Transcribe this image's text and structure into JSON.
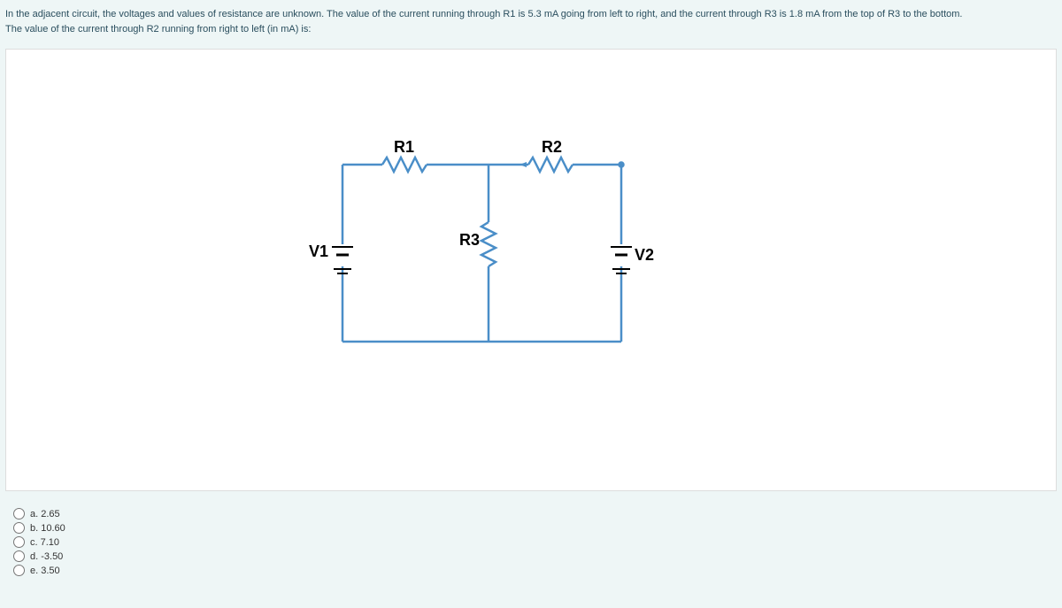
{
  "question": {
    "line1": "In the adjacent circuit, the voltages and values of resistance are unknown. The value of the current running through R1 is 5.3 mA going from left to right, and the current through R3 is 1.8 mA from the top of R3 to the bottom.",
    "line2": "The value of the current through R2 running from right to left (in mA) is:"
  },
  "circuit": {
    "labels": {
      "R1": "R1",
      "R2": "R2",
      "R3": "R3",
      "V1": "V1",
      "V2": "V2"
    }
  },
  "options": {
    "a": "a. 2.65",
    "b": "b. 10.60",
    "c": "c. 7.10",
    "d": "d. -3.50",
    "e": "e. 3.50"
  }
}
